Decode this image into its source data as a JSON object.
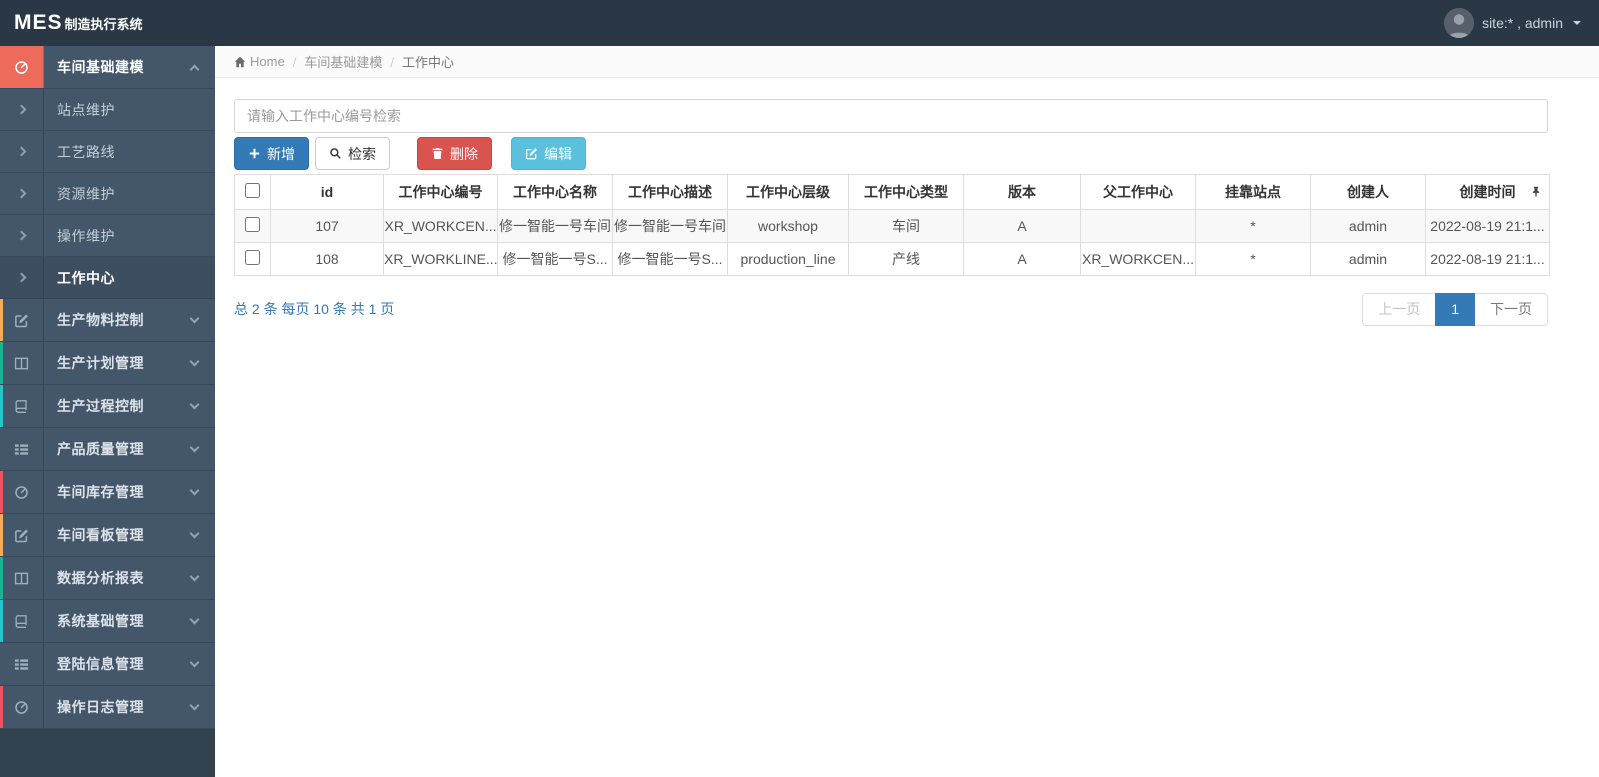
{
  "topbar": {
    "brand": "MES",
    "brand_suffix": "制造执行系统",
    "user_label": "site:* , admin"
  },
  "breadcrumb": [
    "Home",
    "车间基础建模",
    "工作中心"
  ],
  "sidebar": {
    "items": [
      {
        "name": "workshop-base-modeling",
        "label": "车间基础建模",
        "icon": "dashboard-icon",
        "expanded": true,
        "active": true,
        "strip": "",
        "children": [
          {
            "name": "station-maintenance",
            "label": "站点维护"
          },
          {
            "name": "process-route",
            "label": "工艺路线"
          },
          {
            "name": "resource-maintenance",
            "label": "资源维护"
          },
          {
            "name": "operation-maintenance",
            "label": "操作维护"
          },
          {
            "name": "work-center",
            "label": "工作中心",
            "active": true
          }
        ]
      },
      {
        "name": "production-material-control",
        "label": "生产物料控制",
        "icon": "edit-icon",
        "strip": "#f8ac59"
      },
      {
        "name": "production-plan-management",
        "label": "生产计划管理",
        "icon": "columns-icon",
        "strip": "#1ab394"
      },
      {
        "name": "production-process-control",
        "label": "生产过程控制",
        "icon": "book-icon",
        "strip": "#23c6c8"
      },
      {
        "name": "product-quality-management",
        "label": "产品质量管理",
        "icon": "list-icon",
        "strip": ""
      },
      {
        "name": "workshop-inventory-management",
        "label": "车间库存管理",
        "icon": "dashboard-icon",
        "strip": "#ed5565"
      },
      {
        "name": "workshop-kanban-management",
        "label": "车间看板管理",
        "icon": "edit-icon",
        "strip": "#f8ac59"
      },
      {
        "name": "data-analysis-report",
        "label": "数据分析报表",
        "icon": "columns-icon",
        "strip": "#1ab394"
      },
      {
        "name": "system-base-management",
        "label": "系统基础管理",
        "icon": "book-icon",
        "strip": "#23c6c8"
      },
      {
        "name": "login-info-management",
        "label": "登陆信息管理",
        "icon": "list-icon",
        "strip": ""
      },
      {
        "name": "operation-log-management",
        "label": "操作日志管理",
        "icon": "dashboard-icon",
        "strip": "#ed5565"
      }
    ]
  },
  "search": {
    "placeholder": "请输入工作中心编号检索"
  },
  "toolbar": {
    "add": "新增",
    "search": "检索",
    "delete": "删除",
    "edit": "编辑",
    "icons": {
      "add": "plus-icon",
      "search": "search-icon",
      "delete": "trash-icon",
      "edit": "edit-icon"
    }
  },
  "table": {
    "columns": [
      "id",
      "工作中心编号",
      "工作中心名称",
      "工作中心描述",
      "工作中心层级",
      "工作中心类型",
      "版本",
      "父工作中心",
      "挂靠站点",
      "创建人",
      "创建时间"
    ],
    "pin_icon": "pin-icon",
    "rows": [
      [
        "107",
        "XR_WORKCEN...",
        "修一智能一号车间",
        "修一智能一号车间",
        "workshop",
        "车间",
        "A",
        "",
        "*",
        "admin",
        "2022-08-19 21:1..."
      ],
      [
        "108",
        "XR_WORKLINE...",
        "修一智能一号S...",
        "修一智能一号S...",
        "production_line",
        "产线",
        "A",
        "XR_WORKCEN...",
        "*",
        "admin",
        "2022-08-19 21:1..."
      ]
    ]
  },
  "pagination": {
    "summary": "总 2 条 每页 10 条 共 1 页",
    "prev": "上一页",
    "page": "1",
    "next": "下一页"
  },
  "colors": {
    "primary": "#337ab7",
    "danger": "#d9534f",
    "info": "#5bc0de",
    "active_accent": "#ee6a5a",
    "strip_yellow": "#f8ac59",
    "strip_green": "#1ab394",
    "strip_teal": "#23c6c8",
    "strip_red": "#ed5565",
    "topbar_bg": "#2a3744",
    "sidebar_bg": "#43566a"
  }
}
